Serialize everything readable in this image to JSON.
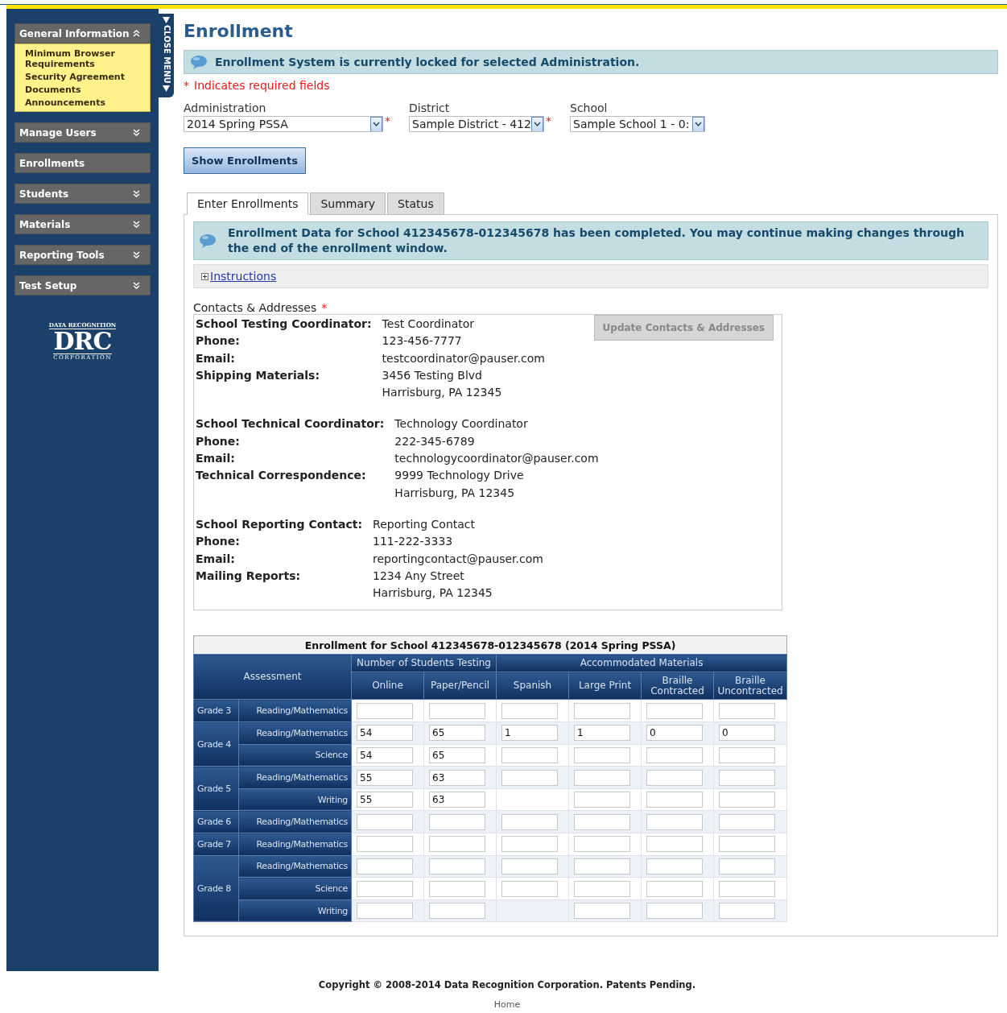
{
  "sidebar": {
    "close_tab": "CLOSE MENU",
    "sections": [
      {
        "label": "General Information",
        "kind": "expandable",
        "expanded": true,
        "items": [
          "Minimum Browser Requirements",
          "Security Agreement",
          "Documents",
          "Announcements"
        ]
      },
      {
        "label": "Manage Users",
        "kind": "expandable",
        "expanded": false
      },
      {
        "label": "Enrollments",
        "kind": "link"
      },
      {
        "label": "Students",
        "kind": "expandable",
        "expanded": false
      },
      {
        "label": "Materials",
        "kind": "expandable",
        "expanded": false
      },
      {
        "label": "Reporting Tools",
        "kind": "expandable",
        "expanded": false
      },
      {
        "label": "Test Setup",
        "kind": "expandable",
        "expanded": false
      }
    ],
    "logo": {
      "top": "DATA RECOGNITION",
      "mark": "DRC",
      "bottom": "CORPORATION"
    }
  },
  "page_title": "Enrollment",
  "alert": "Enrollment System is currently locked for selected Administration.",
  "required_note": {
    "mark": "*",
    "text": "Indicates required fields"
  },
  "filters": [
    {
      "label": "Administration",
      "value": "2014 Spring PSSA",
      "required": true
    },
    {
      "label": "District",
      "value": "Sample District - 412",
      "required": true
    },
    {
      "label": "School",
      "value": "Sample School 1 - 0:",
      "required": false
    }
  ],
  "show_button": "Show Enrollments",
  "tabs": [
    {
      "label": "Enter Enrollments",
      "selected": true
    },
    {
      "label": "Summary",
      "selected": false
    },
    {
      "label": "Status",
      "selected": false
    }
  ],
  "notice": "Enrollment Data for School 412345678-012345678 has been completed. You may continue making changes through the end of the enrollment window.",
  "instructions": {
    "label": "Instructions",
    "expanded": false
  },
  "contacts": {
    "heading": "Contacts & Addresses",
    "required": true,
    "update_button": {
      "label": "Update Contacts & Addresses",
      "disabled": true
    },
    "groups": [
      {
        "rows": [
          {
            "label": "School Testing Coordinator:",
            "lines": [
              "Test Coordinator"
            ]
          },
          {
            "label": "Phone:",
            "lines": [
              "123-456-7777"
            ]
          },
          {
            "label": "Email:",
            "lines": [
              "testcoordinator@pauser.com"
            ]
          },
          {
            "label": "Shipping Materials:",
            "lines": [
              "3456 Testing Blvd",
              "Harrisburg, PA 12345"
            ]
          }
        ]
      },
      {
        "rows": [
          {
            "label": "School Technical Coordinator:",
            "lines": [
              "Technology Coordinator"
            ]
          },
          {
            "label": "Phone:",
            "lines": [
              "222-345-6789"
            ]
          },
          {
            "label": "Email:",
            "lines": [
              "technologycoordinator@pauser.com"
            ]
          },
          {
            "label": "Technical Correspondence:",
            "lines": [
              "9999 Technology Drive",
              "Harrisburg, PA 12345"
            ]
          }
        ]
      },
      {
        "rows": [
          {
            "label": "School Reporting Contact:",
            "lines": [
              "Reporting Contact"
            ]
          },
          {
            "label": "Phone:",
            "lines": [
              "111-222-3333"
            ]
          },
          {
            "label": "Email:",
            "lines": [
              "reportingcontact@pauser.com"
            ]
          },
          {
            "label": "Mailing Reports:",
            "lines": [
              "1234 Any Street",
              "Harrisburg, PA 12345"
            ]
          }
        ]
      }
    ]
  },
  "table": {
    "title": "Enrollment for School 412345678-012345678 (2014 Spring PSSA)",
    "assessment_header": "Assessment",
    "groups": [
      {
        "label": "Number of Students Testing",
        "columns": [
          "Online",
          "Paper/Pencil"
        ]
      },
      {
        "label": "Accommodated Materials",
        "columns": [
          "Spanish",
          "Large Print",
          "Braille Contracted",
          "Braille Uncontracted"
        ]
      }
    ],
    "grades": [
      {
        "grade": "Grade 3",
        "assessments": [
          {
            "name": "Reading/Mathematics",
            "cells": [
              {
                "kind": "input"
              },
              {
                "kind": "input"
              },
              {
                "kind": "input"
              },
              {
                "kind": "input"
              },
              {
                "kind": "input"
              },
              {
                "kind": "input"
              }
            ]
          }
        ]
      },
      {
        "grade": "Grade 4",
        "assessments": [
          {
            "name": "Reading/Mathematics",
            "cells": [
              {
                "kind": "input",
                "value": "54"
              },
              {
                "kind": "input",
                "value": "65"
              },
              {
                "kind": "input",
                "value": "1"
              },
              {
                "kind": "input",
                "value": "1"
              },
              {
                "kind": "input",
                "value": "0"
              },
              {
                "kind": "input",
                "value": "0"
              }
            ]
          },
          {
            "name": "Science",
            "cells": [
              {
                "kind": "input",
                "value": "54"
              },
              {
                "kind": "input",
                "value": "65"
              },
              {
                "kind": "input"
              },
              {
                "kind": "input"
              },
              {
                "kind": "input"
              },
              {
                "kind": "input"
              }
            ]
          }
        ]
      },
      {
        "grade": "Grade 5",
        "assessments": [
          {
            "name": "Reading/Mathematics",
            "cells": [
              {
                "kind": "input",
                "value": "55"
              },
              {
                "kind": "input",
                "value": "63"
              },
              {
                "kind": "input"
              },
              {
                "kind": "input"
              },
              {
                "kind": "input"
              },
              {
                "kind": "input"
              }
            ]
          },
          {
            "name": "Writing",
            "cells": [
              {
                "kind": "input",
                "value": "55"
              },
              {
                "kind": "input",
                "value": "63"
              },
              {
                "kind": "none"
              },
              {
                "kind": "input"
              },
              {
                "kind": "input"
              },
              {
                "kind": "input"
              }
            ]
          }
        ]
      },
      {
        "grade": "Grade 6",
        "assessments": [
          {
            "name": "Reading/Mathematics",
            "cells": [
              {
                "kind": "input"
              },
              {
                "kind": "input"
              },
              {
                "kind": "input"
              },
              {
                "kind": "input"
              },
              {
                "kind": "input"
              },
              {
                "kind": "input"
              }
            ]
          }
        ]
      },
      {
        "grade": "Grade 7",
        "assessments": [
          {
            "name": "Reading/Mathematics",
            "cells": [
              {
                "kind": "input"
              },
              {
                "kind": "input"
              },
              {
                "kind": "input"
              },
              {
                "kind": "input"
              },
              {
                "kind": "input"
              },
              {
                "kind": "input"
              }
            ]
          }
        ]
      },
      {
        "grade": "Grade 8",
        "assessments": [
          {
            "name": "Reading/Mathematics",
            "cells": [
              {
                "kind": "input"
              },
              {
                "kind": "input"
              },
              {
                "kind": "input"
              },
              {
                "kind": "input"
              },
              {
                "kind": "input"
              },
              {
                "kind": "input"
              }
            ]
          },
          {
            "name": "Science",
            "cells": [
              {
                "kind": "input"
              },
              {
                "kind": "input"
              },
              {
                "kind": "input"
              },
              {
                "kind": "input"
              },
              {
                "kind": "input"
              },
              {
                "kind": "input"
              }
            ]
          },
          {
            "name": "Writing",
            "cells": [
              {
                "kind": "input"
              },
              {
                "kind": "input"
              },
              {
                "kind": "none"
              },
              {
                "kind": "input"
              },
              {
                "kind": "input"
              },
              {
                "kind": "input"
              }
            ]
          }
        ]
      }
    ]
  },
  "footer": {
    "copyright": "Copyright © 2008-2014 Data Recognition Corporation. Patents Pending.",
    "home_link": "Home"
  }
}
